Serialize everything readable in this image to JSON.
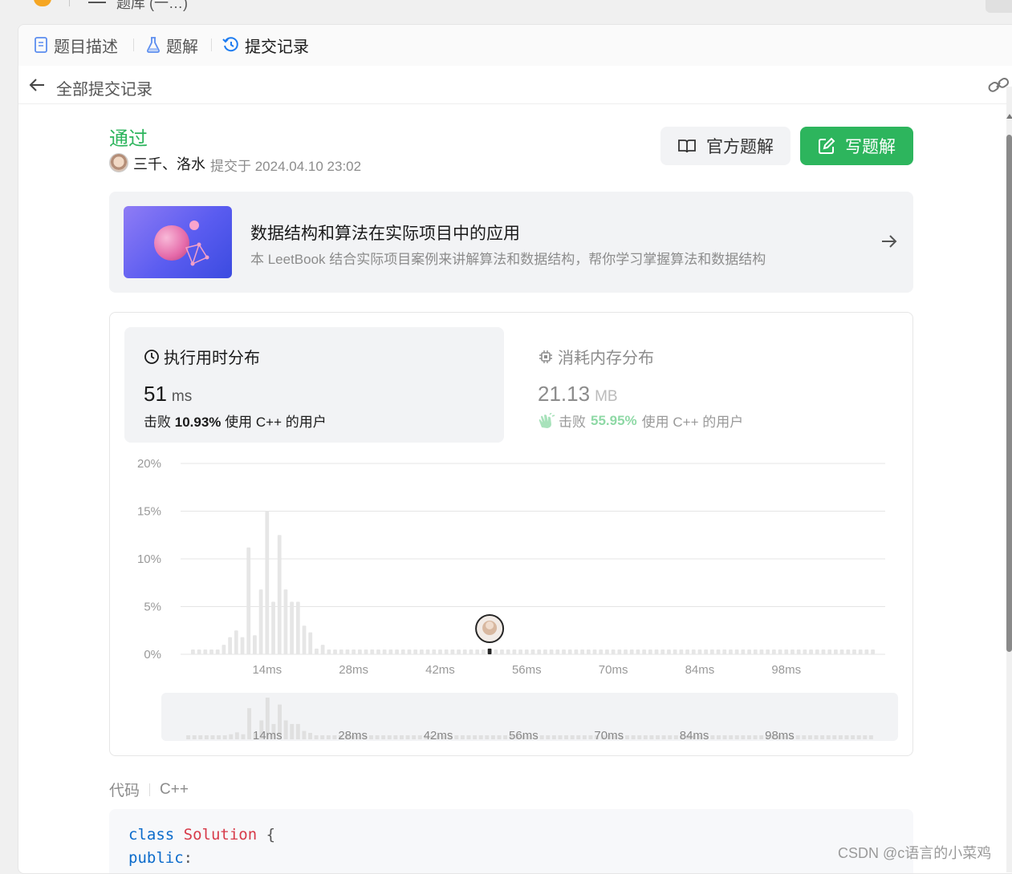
{
  "top": {
    "title_fragment": "题库 (一…)"
  },
  "tabs": [
    {
      "label": "题目描述",
      "icon": "document-icon"
    },
    {
      "label": "题解",
      "icon": "flask-icon"
    },
    {
      "label": "提交记录",
      "icon": "history-icon"
    }
  ],
  "subheader": {
    "title": "全部提交记录"
  },
  "submission": {
    "status": "通过",
    "author": "三千、洛水",
    "submitted_at": "提交于 2024.04.10 23:02"
  },
  "buttons": {
    "official": "官方题解",
    "write": "写题解"
  },
  "banner": {
    "title": "数据结构和算法在实际项目中的应用",
    "desc": "本 LeetBook 结合实际项目案例来讲解算法和数据结构，帮你学习掌握算法和数据结构"
  },
  "runtime": {
    "title": "执行用时分布",
    "value": "51",
    "unit": "ms",
    "beat_prefix": "击败",
    "beat_pct": "10.93%",
    "beat_suffix": "使用 C++ 的用户"
  },
  "memory": {
    "title": "消耗内存分布",
    "value": "21.13",
    "unit": "MB",
    "beat_prefix": "击败",
    "beat_pct": "55.95%",
    "beat_suffix": "使用 C++ 的用户"
  },
  "chart_data": {
    "type": "bar",
    "y_ticks": [
      "20%",
      "15%",
      "10%",
      "5%",
      "0%"
    ],
    "ylim": [
      0,
      20
    ],
    "x_ticks": [
      "14ms",
      "28ms",
      "42ms",
      "56ms",
      "70ms",
      "84ms",
      "98ms"
    ],
    "x_tick_values": [
      14,
      28,
      42,
      56,
      70,
      84,
      98
    ],
    "xlim": [
      0,
      114
    ],
    "bars": [
      {
        "x": 2,
        "value": 0.5
      },
      {
        "x": 3,
        "value": 0.5
      },
      {
        "x": 4,
        "value": 0.5
      },
      {
        "x": 5,
        "value": 0.5
      },
      {
        "x": 6,
        "value": 0.5
      },
      {
        "x": 7,
        "value": 1.0
      },
      {
        "x": 8,
        "value": 1.8
      },
      {
        "x": 9,
        "value": 2.5
      },
      {
        "x": 10,
        "value": 1.8
      },
      {
        "x": 11,
        "value": 11.2
      },
      {
        "x": 12,
        "value": 2.0
      },
      {
        "x": 13,
        "value": 6.8
      },
      {
        "x": 14,
        "value": 15.0
      },
      {
        "x": 15,
        "value": 5.5
      },
      {
        "x": 16,
        "value": 12.5
      },
      {
        "x": 17,
        "value": 6.8
      },
      {
        "x": 18,
        "value": 5.5
      },
      {
        "x": 19,
        "value": 5.5
      },
      {
        "x": 20,
        "value": 3.0
      },
      {
        "x": 21,
        "value": 2.3
      },
      {
        "x": 22,
        "value": 0.6
      },
      {
        "x": 23,
        "value": 1.0
      },
      {
        "x": 24,
        "value": 0.5
      },
      {
        "x": 50,
        "value": 0.6
      }
    ],
    "baseline_value": 0.5,
    "highlight_x": 50,
    "mini_ticks": [
      "14ms",
      "28ms",
      "42ms",
      "56ms",
      "70ms",
      "84ms",
      "98ms"
    ]
  },
  "code": {
    "label": "代码",
    "language": "C++",
    "lines": [
      {
        "kw": "class",
        "name": "Solution",
        "rest": "{"
      },
      {
        "kw": "public",
        "rest": ":"
      }
    ]
  },
  "watermark": "CSDN @c语言的小菜鸡"
}
